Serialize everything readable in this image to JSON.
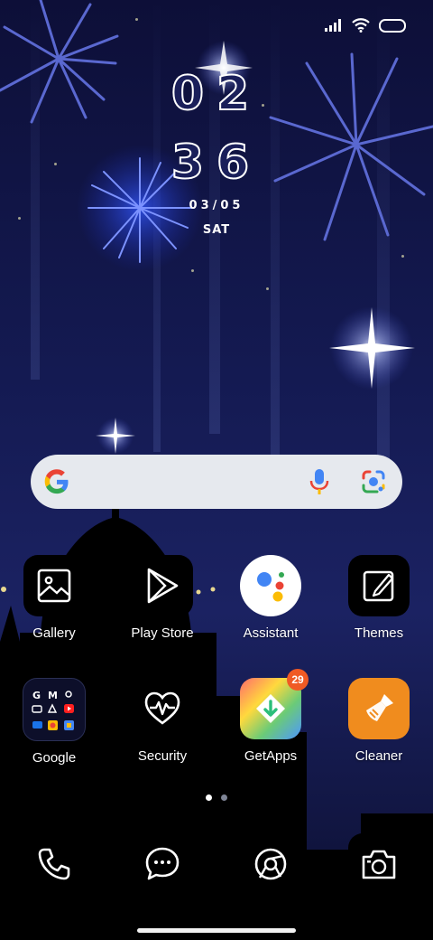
{
  "clock": {
    "hours": "02",
    "minutes": "36",
    "date": "03/05",
    "day": "SAT"
  },
  "home_row1": [
    {
      "label": "Gallery",
      "icon": "gallery-icon"
    },
    {
      "label": "Play Store",
      "icon": "play-store-icon"
    },
    {
      "label": "Assistant",
      "icon": "assistant-icon"
    },
    {
      "label": "Themes",
      "icon": "themes-icon"
    }
  ],
  "home_row2": [
    {
      "label": "Google",
      "icon": "google-folder-icon"
    },
    {
      "label": "Security",
      "icon": "security-icon"
    },
    {
      "label": "GetApps",
      "icon": "getapps-icon",
      "badge": "29"
    },
    {
      "label": "Cleaner",
      "icon": "cleaner-icon"
    }
  ],
  "dock": [
    {
      "icon": "phone-icon"
    },
    {
      "icon": "messages-icon"
    },
    {
      "icon": "browser-icon"
    },
    {
      "icon": "camera-icon"
    }
  ],
  "page_indicator": {
    "pages": 2,
    "current": 1
  },
  "colors": {
    "wallpaper_top": "#0d0f38",
    "wallpaper_mid": "#1b2262",
    "search_bar": "#e6e9ee",
    "badge": "#f05a24",
    "cleaner": "#f08c1e"
  }
}
